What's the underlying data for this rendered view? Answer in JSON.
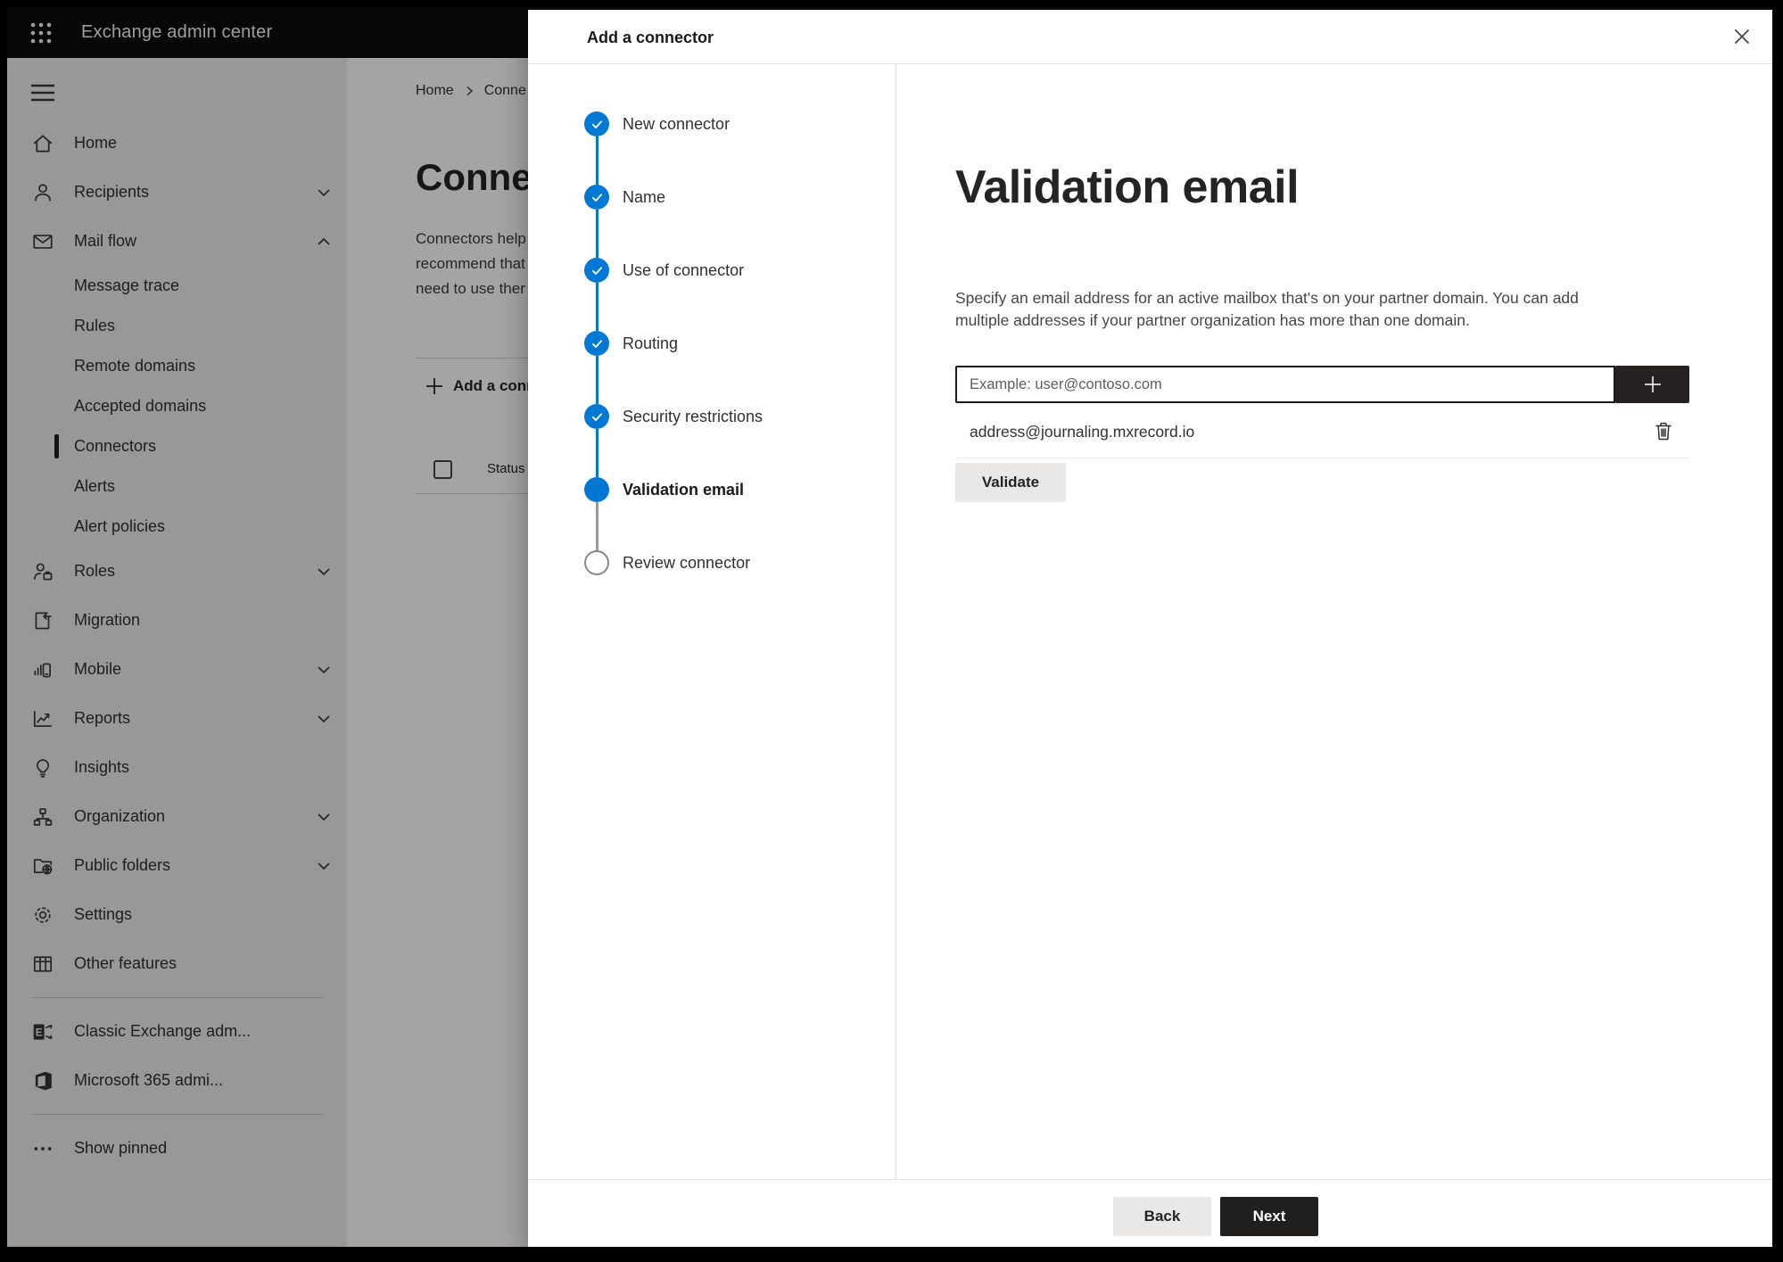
{
  "topbar": {
    "title": "Exchange admin center"
  },
  "sidebar": {
    "items": [
      {
        "type": "top",
        "label": "Home",
        "icon": "home"
      },
      {
        "type": "top",
        "label": "Recipients",
        "icon": "person",
        "chevron": "down"
      },
      {
        "type": "top",
        "label": "Mail flow",
        "icon": "mail",
        "chevron": "up"
      },
      {
        "type": "sub",
        "label": "Message trace"
      },
      {
        "type": "sub",
        "label": "Rules"
      },
      {
        "type": "sub",
        "label": "Remote domains"
      },
      {
        "type": "sub",
        "label": "Accepted domains"
      },
      {
        "type": "sub",
        "label": "Connectors",
        "selected": true
      },
      {
        "type": "sub",
        "label": "Alerts"
      },
      {
        "type": "sub",
        "label": "Alert policies"
      },
      {
        "type": "top",
        "label": "Roles",
        "icon": "roles",
        "chevron": "down"
      },
      {
        "type": "top",
        "label": "Migration",
        "icon": "migration"
      },
      {
        "type": "top",
        "label": "Mobile",
        "icon": "mobile",
        "chevron": "down"
      },
      {
        "type": "top",
        "label": "Reports",
        "icon": "reports",
        "chevron": "down"
      },
      {
        "type": "top",
        "label": "Insights",
        "icon": "insights"
      },
      {
        "type": "top",
        "label": "Organization",
        "icon": "organization",
        "chevron": "down"
      },
      {
        "type": "top",
        "label": "Public folders",
        "icon": "folders",
        "chevron": "down"
      },
      {
        "type": "top",
        "label": "Settings",
        "icon": "settings"
      },
      {
        "type": "top",
        "label": "Other features",
        "icon": "grid"
      },
      {
        "type": "divider"
      },
      {
        "type": "top",
        "label": "Classic Exchange adm...",
        "icon": "exchange"
      },
      {
        "type": "top",
        "label": "Microsoft 365 admi...",
        "icon": "office"
      },
      {
        "type": "divider"
      },
      {
        "type": "top",
        "label": "Show pinned",
        "icon": "ellipsis"
      }
    ]
  },
  "page": {
    "breadcrumb": {
      "home": "Home",
      "current": "Conne"
    },
    "title": "Connect",
    "description_lines": [
      "Connectors help",
      "recommend that",
      "need to use ther"
    ],
    "add_button_label": "Add a conn",
    "table": {
      "status_header": "Status"
    }
  },
  "dialog": {
    "title": "Add a connector",
    "steps": [
      {
        "label": "New connector",
        "state": "done"
      },
      {
        "label": "Name",
        "state": "done"
      },
      {
        "label": "Use of connector",
        "state": "done"
      },
      {
        "label": "Routing",
        "state": "done"
      },
      {
        "label": "Security restrictions",
        "state": "done"
      },
      {
        "label": "Validation email",
        "state": "current"
      },
      {
        "label": "Review connector",
        "state": "todo"
      }
    ],
    "content": {
      "heading": "Validation email",
      "description_line1": "Specify an email address for an active mailbox that's on your partner domain. You can add",
      "description_line2": "multiple addresses if your partner organization has more than one domain.",
      "email_placeholder": "Example: user@contoso.com",
      "addresses": [
        "address@journaling.mxrecord.io"
      ],
      "validate_button": "Validate"
    },
    "footer": {
      "back": "Back",
      "next": "Next"
    }
  },
  "colors": {
    "accent": "#0078d4",
    "step_todo_border": "#8a8886",
    "dark_button": "#201f1e"
  }
}
